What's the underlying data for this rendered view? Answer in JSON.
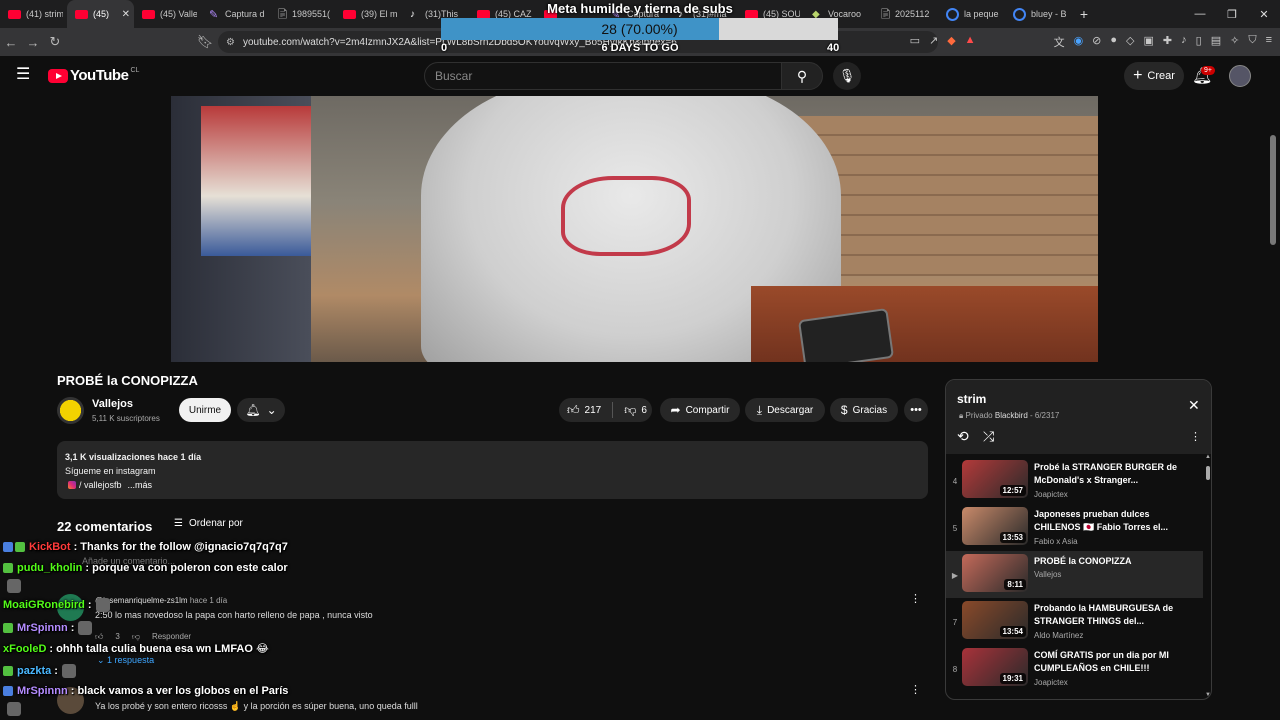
{
  "browser": {
    "tabs": [
      {
        "label": "(41) strim",
        "icon": "yt"
      },
      {
        "label": "(45) ",
        "icon": "yt",
        "active": true
      },
      {
        "label": "(45) Valle",
        "icon": "yt"
      },
      {
        "label": "Captura d",
        "icon": "cap"
      },
      {
        "label": "1989551(",
        "icon": "doc"
      },
      {
        "label": "(39) El m",
        "icon": "yt"
      },
      {
        "label": "(31)This",
        "icon": "tt"
      },
      {
        "label": "(45) CAZ",
        "icon": "yt"
      },
      {
        "label": "",
        "icon": "yt"
      },
      {
        "label": "Captura",
        "icon": "cap"
      },
      {
        "label": "(31)#ma",
        "icon": "tt"
      },
      {
        "label": "(45) SOU",
        "icon": "yt"
      },
      {
        "label": "Vocaroo",
        "icon": "voc"
      },
      {
        "label": "2025112",
        "icon": "doc"
      },
      {
        "label": "la peque",
        "icon": "goo"
      },
      {
        "label": "bluey - B",
        "icon": "goo"
      }
    ],
    "url": "youtube.com/watch?v=2m4IzmnJX2A&list=PLWL8bSrn2Dbd5OKYouvqWxy_Bo5HyIkKh&index=6"
  },
  "overlay": {
    "goal_title": "Meta humilde y tierna de subs :')",
    "goal_count": "28 (70.00%)",
    "goal_progress": 0.7,
    "goal_min": "0",
    "goal_max": "40",
    "goal_days": "6 DAYS TO GO"
  },
  "youtube": {
    "logo_text": "YouTube",
    "country": "CL",
    "search_placeholder": "Buscar",
    "create_label": "Crear",
    "notif_badge": "9+"
  },
  "video": {
    "title": "PROBÉ la CONOPIZZA",
    "channel": "Vallejos",
    "subscribers": "5,11 K suscriptores",
    "join_label": "Unirme",
    "likes": "217",
    "dislikes": "6",
    "share_label": "Compartir",
    "download_label": "Descargar",
    "thanks_label": "Gracias"
  },
  "description": {
    "stats": "3,1 K visualizaciones  hace 1 día",
    "line1": "Sígueme en instagram",
    "ig_link": "/ vallejosfb",
    "more": "...más"
  },
  "comments": {
    "count_label": "22 comentarios",
    "sort_label": "Ordenar por",
    "placeholder": "Añade un comentario...",
    "items": [
      {
        "author": "@josemanriquelme-zs1lm",
        "time": "hace 1 día",
        "text": "2:50 lo mas novedoso la papa con harto relleno de papa , nunca visto",
        "likes": "3",
        "reply_label": "Responder",
        "replies": "1 respuesta"
      },
      {
        "text": "Ya los probé y son entero ricosss ☝️ y la porción es súper buena, uno queda fulll"
      }
    ]
  },
  "chat": [
    {
      "user": "KickBot",
      "color": "#ff3b3b",
      "badges": [
        "#4a7fe0",
        "#53c040"
      ],
      "msg": ": Thanks for the follow @ignacio7q7q7q7"
    },
    {
      "user": "pudu_kholin",
      "color": "#53fc18",
      "badges": [
        "#53c040"
      ],
      "msg": ": porque va con poleron con este calor"
    },
    {
      "user": "",
      "color": "#fff",
      "badges": [],
      "msg": "",
      "emote": true
    },
    {
      "user": "MoaiGRonebird",
      "color": "#53fc18",
      "badges": [],
      "msg": ":",
      "emote": true
    },
    {
      "user": "MrSpinnn",
      "color": "#b48cff",
      "badges": [
        "#53c040"
      ],
      "msg": ":",
      "emote": true
    },
    {
      "user": "xFooleD",
      "color": "#53fc18",
      "badges": [],
      "msg": ": ohhh talla culia buena esa wn LMFAO 😂"
    },
    {
      "user": "pazkta",
      "color": "#4ab8ff",
      "badges": [
        "#53c040"
      ],
      "msg": ":",
      "emote": true
    },
    {
      "user": "MrSpinnn",
      "color": "#b48cff",
      "badges": [
        "#4a7fe0"
      ],
      "msg": ": black vamos a ver los globos en el París"
    },
    {
      "user": "",
      "color": "#fff",
      "badges": [],
      "msg": "",
      "emote": true
    }
  ],
  "playlist": {
    "title": "strim",
    "privacy": "Privado",
    "owner": "Blackbird",
    "position": "- 6/2317",
    "items": [
      {
        "index": "4",
        "title": "Probé la STRANGER BURGER de McDonald's x Stranger...",
        "channel": "Joapictex",
        "duration": "12:57",
        "thumb": "#b33a3a"
      },
      {
        "index": "5",
        "title": "Japoneses prueban dulces CHILENOS 🇯🇵 Fabio Torres el...",
        "channel": "Fabio x Asia",
        "duration": "13:53",
        "thumb": "#c98a6a"
      },
      {
        "index": "▶",
        "title": "PROBÉ la CONOPIZZA",
        "channel": "Vallejos",
        "duration": "8:11",
        "thumb": "#c46a5a",
        "current": true
      },
      {
        "index": "7",
        "title": "Probando la HAMBURGUESA de STRANGER THINGS del...",
        "channel": "Aldo Martínez",
        "duration": "13:54",
        "thumb": "#8a4a2a"
      },
      {
        "index": "8",
        "title": "COMÍ GRATIS por un dia por MI CUMPLEAÑOS en CHILE!!!",
        "channel": "Joapictex",
        "duration": "19:31",
        "thumb": "#a8323a"
      }
    ]
  }
}
